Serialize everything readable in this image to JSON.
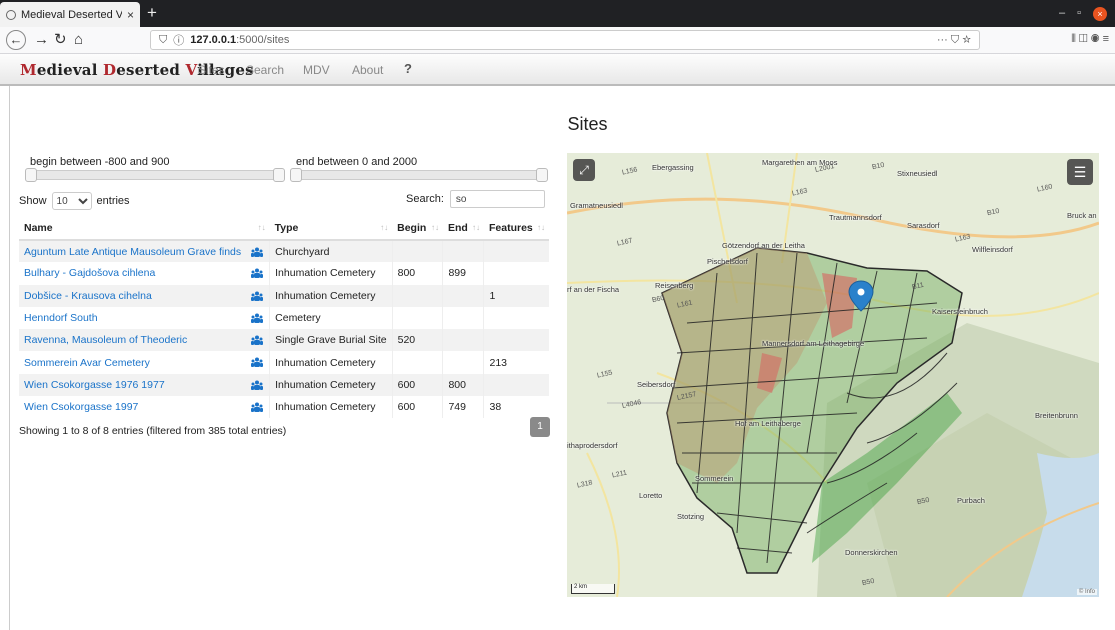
{
  "browser": {
    "tab_title": "Medieval Deserted Villa",
    "tab_close": "×",
    "new_tab": "+",
    "url_host": "127.0.0.1",
    "url_path": ":5000/sites",
    "url_icons": "··· ⛉ ☆",
    "toolbar_icons": "⫴ ◫ ◉ ≡"
  },
  "app": {
    "brand_parts": [
      "M",
      "edieval ",
      "D",
      "eserted ",
      "V",
      "illages"
    ],
    "menu": [
      "Sites",
      "Search",
      "MDV",
      "About",
      "?"
    ]
  },
  "page": {
    "title": "Sites"
  },
  "filters": {
    "begin_label": "begin between -800 and 900",
    "end_label": "end between 0 and 2000"
  },
  "table_controls": {
    "show_label": "Show",
    "entries_label": "entries",
    "page_length": "10",
    "search_label": "Search:",
    "search_value": "so"
  },
  "table": {
    "headers": [
      "Name",
      "Type",
      "Begin",
      "End",
      "Features"
    ],
    "rows": [
      {
        "name": "Aguntum Late Antique Mausoleum Grave finds",
        "type": "Churchyard",
        "begin": "",
        "end": "",
        "features": ""
      },
      {
        "name": "Bulhary - Gajdošova cihlena",
        "type": "Inhumation Cemetery",
        "begin": "800",
        "end": "899",
        "features": ""
      },
      {
        "name": "Dobšice - Krausova cihelna",
        "type": "Inhumation Cemetery",
        "begin": "",
        "end": "",
        "features": "1"
      },
      {
        "name": "Henndorf South",
        "type": "Cemetery",
        "begin": "",
        "end": "",
        "features": ""
      },
      {
        "name": "Ravenna, Mausoleum of Theoderic",
        "type": "Single Grave Burial Site",
        "begin": "520",
        "end": "",
        "features": ""
      },
      {
        "name": "Sommerein Avar Cemetery",
        "type": "Inhumation Cemetery",
        "begin": "",
        "end": "",
        "features": "213"
      },
      {
        "name": "Wien Csokorgasse 1976 1977",
        "type": "Inhumation Cemetery",
        "begin": "600",
        "end": "800",
        "features": ""
      },
      {
        "name": "Wien Csokorgasse 1997",
        "type": "Inhumation Cemetery",
        "begin": "600",
        "end": "749",
        "features": "38"
      }
    ],
    "info": "Showing 1 to 8 of 8 entries (filtered from 385 total entries)",
    "page": "1"
  },
  "map": {
    "places": [
      "Ebergassing",
      "Margarethen am Moos",
      "Stixneusiedl",
      "Gramatneusiedl",
      "Trautmannsdorf",
      "Sarasdorf",
      "Bruck an d",
      "Götzendorf an der Leitha",
      "Wilfleinsdorf",
      "Pischelsdorf",
      "Reisenberg",
      "rf an der Fischa",
      "Kaisersteinbruch",
      "Mannersdorf am Leithagebirge",
      "Seibersdorf",
      "Hof am Leithaberge",
      "Breitenbrunn",
      "ithaprodersdorf",
      "Loretto",
      "Sommerein",
      "Stotzing",
      "Purbach",
      "Donnerskirchen"
    ],
    "roads": [
      "L156",
      "L2001",
      "B10",
      "L163",
      "B10",
      "L160",
      "L163",
      "L167",
      "B60",
      "L161",
      "B11",
      "L155",
      "L4046",
      "L2157",
      "L211",
      "L318",
      "B50",
      "B50"
    ],
    "scale": "2 km",
    "attribution": "© Info",
    "fullscreen_icon": "fullscreen-icon",
    "layers_icon": "layers-icon"
  }
}
